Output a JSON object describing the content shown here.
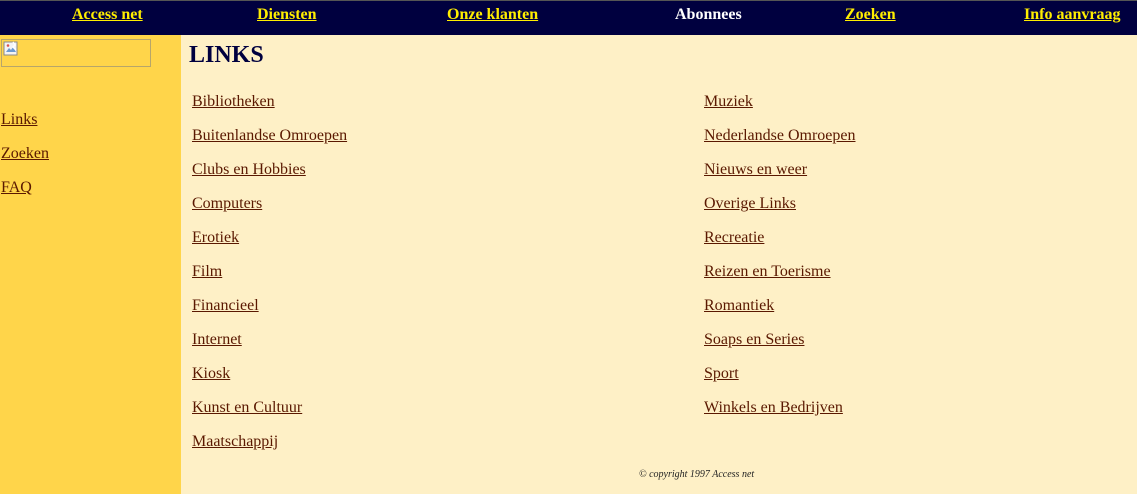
{
  "topnav": {
    "items": [
      {
        "label": "Access net",
        "current": false
      },
      {
        "label": "Diensten",
        "current": false
      },
      {
        "label": "Onze klanten",
        "current": false
      },
      {
        "label": "Abonnees",
        "current": true
      },
      {
        "label": "Zoeken",
        "current": false
      },
      {
        "label": "Info aanvraag",
        "current": false
      }
    ]
  },
  "sidebar": {
    "logo_icon": "broken-image-icon",
    "links": [
      "Links",
      "Zoeken",
      "FAQ"
    ]
  },
  "main": {
    "title": "LINKS",
    "left_links": [
      "Bibliotheken",
      "Buitenlandse Omroepen",
      "Clubs en Hobbies",
      "Computers",
      "Erotiek",
      "Film",
      "Financieel",
      "Internet",
      "Kiosk",
      "Kunst en Cultuur",
      "Maatschappij"
    ],
    "right_links": [
      "Muziek",
      "Nederlandse Omroepen",
      "Nieuws en weer",
      "Overige Links",
      "Recreatie",
      "Reizen en Toerisme",
      "Romantiek",
      "Soaps en Series",
      "Sport",
      "Winkels en Bedrijven"
    ],
    "copyright": "© copyright 1997 Access net"
  },
  "colors": {
    "nav_bg": "#00003f",
    "nav_link": "#ffee00",
    "sidebar_bg": "#ffd54a",
    "main_bg": "#fef0c6",
    "link": "#5a1800",
    "title": "#00003f"
  }
}
